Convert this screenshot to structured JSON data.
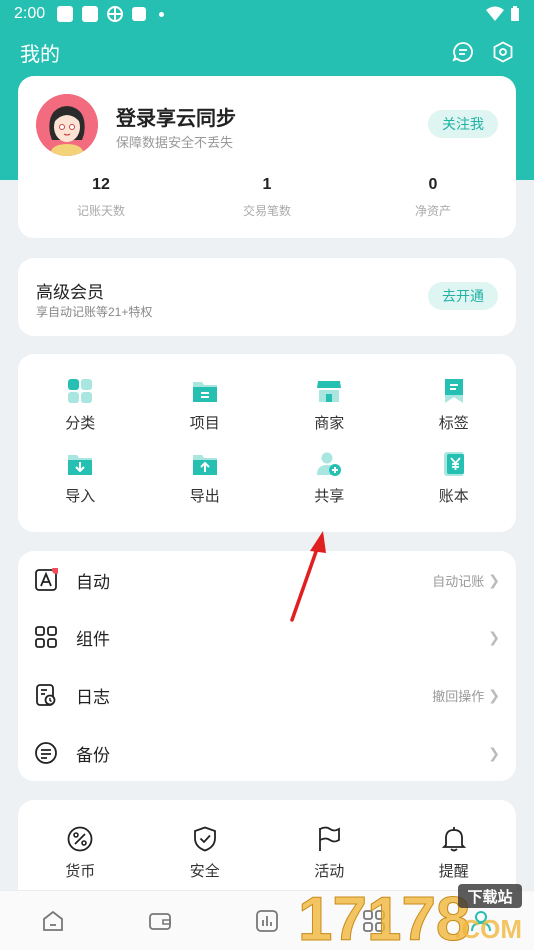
{
  "status_bar": {
    "time": "2:00"
  },
  "header": {
    "title": "我的"
  },
  "profile": {
    "name": "登录享云同步",
    "subtitle": "保障数据安全不丢失",
    "follow_label": "关注我",
    "stats": [
      {
        "value": "12",
        "label": "记账天数"
      },
      {
        "value": "1",
        "label": "交易笔数"
      },
      {
        "value": "0",
        "label": "净资产"
      }
    ]
  },
  "member": {
    "title": "高级会员",
    "subtitle": "享自动记账等21+特权",
    "action_label": "去开通"
  },
  "grid": {
    "items": [
      {
        "label": "分类",
        "icon": "category-icon"
      },
      {
        "label": "项目",
        "icon": "project-folder-icon"
      },
      {
        "label": "商家",
        "icon": "merchant-store-icon"
      },
      {
        "label": "标签",
        "icon": "tag-bookmark-icon"
      },
      {
        "label": "导入",
        "icon": "import-icon"
      },
      {
        "label": "导出",
        "icon": "export-icon"
      },
      {
        "label": "共享",
        "icon": "share-user-icon"
      },
      {
        "label": "账本",
        "icon": "ledger-yen-icon"
      }
    ]
  },
  "list": {
    "rows": [
      {
        "label": "自动",
        "right": "自动记账",
        "icon": "auto-icon"
      },
      {
        "label": "组件",
        "right": "",
        "icon": "widget-icon"
      },
      {
        "label": "日志",
        "right": "撤回操作",
        "icon": "log-icon"
      },
      {
        "label": "备份",
        "right": "",
        "icon": "backup-icon"
      }
    ]
  },
  "bottom": {
    "items": [
      {
        "label": "货币",
        "icon": "currency-percent-icon"
      },
      {
        "label": "安全",
        "icon": "shield-check-icon"
      },
      {
        "label": "活动",
        "icon": "flag-icon"
      },
      {
        "label": "提醒",
        "icon": "bell-icon"
      }
    ]
  },
  "watermark": {
    "text": "17178",
    "site": "下载站",
    "domain": ".COM"
  },
  "colors": {
    "accent": "#26c0b2",
    "accent_light": "#dff5f2",
    "badge": "#f24c5c",
    "arrow": "#e02020"
  }
}
